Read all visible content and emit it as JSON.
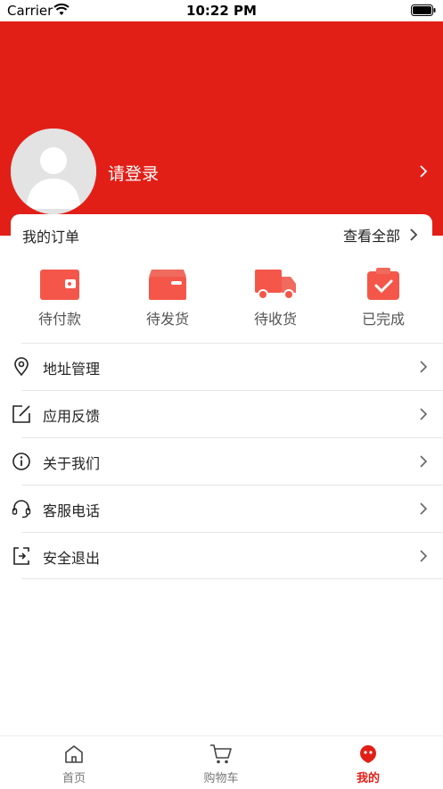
{
  "status_bar": {
    "carrier": "Carrier",
    "time": "10:22 PM"
  },
  "profile": {
    "login_prompt": "请登录"
  },
  "orders": {
    "title": "我的订单",
    "view_all": "查看全部",
    "items": [
      {
        "label": "待付款",
        "icon": "wallet-icon"
      },
      {
        "label": "待发货",
        "icon": "box-icon"
      },
      {
        "label": "待收货",
        "icon": "truck-icon"
      },
      {
        "label": "已完成",
        "icon": "clipboard-check-icon"
      }
    ],
    "icon_color": "#f4574a"
  },
  "menu": [
    {
      "label": "地址管理",
      "icon": "location-pin-icon"
    },
    {
      "label": "应用反馈",
      "icon": "edit-square-icon"
    },
    {
      "label": "关于我们",
      "icon": "info-circle-icon"
    },
    {
      "label": "客服电话",
      "icon": "headset-icon"
    },
    {
      "label": "安全退出",
      "icon": "logout-icon"
    }
  ],
  "tabbar": {
    "items": [
      {
        "label": "首页",
        "icon": "home-icon",
        "active": false
      },
      {
        "label": "购物车",
        "icon": "cart-icon",
        "active": false
      },
      {
        "label": "我的",
        "icon": "profile-face-icon",
        "active": true
      }
    ]
  },
  "colors": {
    "brand": "#e21f17",
    "separator": "#e6e6e6"
  }
}
